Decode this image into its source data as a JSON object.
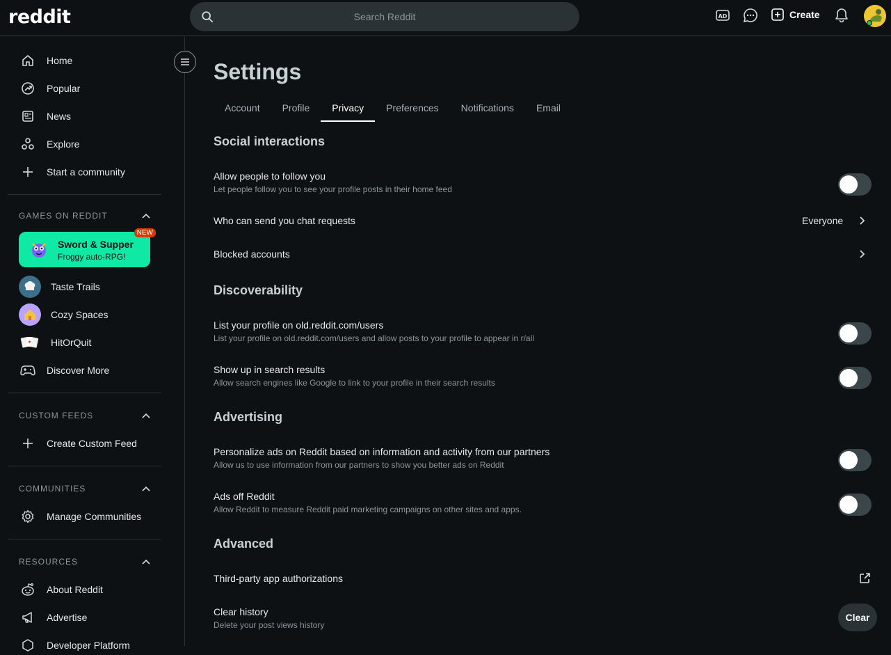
{
  "header": {
    "logo": "reddit",
    "search_placeholder": "Search Reddit",
    "create_label": "Create",
    "colors": {
      "bg": "#0e1113",
      "search_bg": "#2a3236"
    }
  },
  "sidebar": {
    "nav": [
      {
        "label": "Home",
        "icon": "home-icon"
      },
      {
        "label": "Popular",
        "icon": "popular-icon"
      },
      {
        "label": "News",
        "icon": "news-icon"
      },
      {
        "label": "Explore",
        "icon": "explore-icon"
      },
      {
        "label": "Start a community",
        "icon": "plus-icon"
      }
    ],
    "games": {
      "title": "GAMES ON REDDIT",
      "featured": {
        "title": "Sword & Supper",
        "subtitle": "Froggy auto-RPG!",
        "badge": "NEW",
        "color": "#10e8a5"
      },
      "items": [
        {
          "label": "Taste Trails"
        },
        {
          "label": "Cozy Spaces"
        },
        {
          "label": "HitOrQuit"
        },
        {
          "label": "Discover More"
        }
      ]
    },
    "custom_feeds": {
      "title": "CUSTOM FEEDS",
      "items": [
        {
          "label": "Create Custom Feed"
        }
      ]
    },
    "communities": {
      "title": "COMMUNITIES",
      "items": [
        {
          "label": "Manage Communities"
        }
      ]
    },
    "resources": {
      "title": "RESOURCES",
      "items": [
        {
          "label": "About Reddit"
        },
        {
          "label": "Advertise"
        },
        {
          "label": "Developer Platform"
        }
      ]
    }
  },
  "settings": {
    "title": "Settings",
    "tabs": [
      "Account",
      "Profile",
      "Privacy",
      "Preferences",
      "Notifications",
      "Email"
    ],
    "active_tab": "Privacy",
    "social": {
      "title": "Social interactions",
      "follow": {
        "title": "Allow people to follow you",
        "desc": "Let people follow you to see your profile posts in their home feed",
        "on": false
      },
      "chat": {
        "title": "Who can send you chat requests",
        "value": "Everyone"
      },
      "blocked": {
        "title": "Blocked accounts"
      }
    },
    "discoverability": {
      "title": "Discoverability",
      "list_profile": {
        "title": "List your profile on old.reddit.com/users",
        "desc": "List your profile on old.reddit.com/users and allow posts to your profile to appear in r/all",
        "on": false
      },
      "search": {
        "title": "Show up in search results",
        "desc": "Allow search engines like Google to link to your profile in their search results",
        "on": false
      }
    },
    "advertising": {
      "title": "Advertising",
      "personalize": {
        "title": "Personalize ads on Reddit based on information and activity from our partners",
        "desc": "Allow us to use information from our partners to show you better ads on Reddit",
        "on": false
      },
      "ads_off": {
        "title": "Ads off Reddit",
        "desc": "Allow Reddit to measure Reddit paid marketing campaigns on other sites and apps.",
        "on": false
      }
    },
    "advanced": {
      "title": "Advanced",
      "third_party": {
        "title": "Third-party app authorizations"
      },
      "clear_history": {
        "title": "Clear history",
        "desc": "Delete your post views history",
        "button": "Clear"
      }
    }
  }
}
